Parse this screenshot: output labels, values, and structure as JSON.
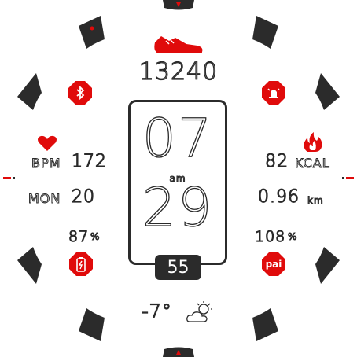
{
  "steps": "13240",
  "heart": {
    "label": "BPM",
    "value": "172"
  },
  "date": {
    "day": "MON",
    "num": "20"
  },
  "battery": {
    "value": "87",
    "unit": "%"
  },
  "calories": {
    "value": "82",
    "unit": "KCAL"
  },
  "distance": {
    "value": "0.96",
    "unit": "km"
  },
  "pai": {
    "value": "108",
    "unit": "%",
    "icon_label": "pai"
  },
  "time": {
    "hour": "07",
    "ampm": "am",
    "minute": "29",
    "second": "55"
  },
  "weather": {
    "temp": "-7°",
    "icon": "partly-cloudy-icon"
  },
  "icons": [
    "shoe-icon",
    "bluetooth-icon",
    "alarm-icon",
    "heart-icon",
    "fire-icon",
    "battery-icon"
  ],
  "colors": {
    "accent": "#e00b0b",
    "bezel": "#2b2b2b"
  }
}
